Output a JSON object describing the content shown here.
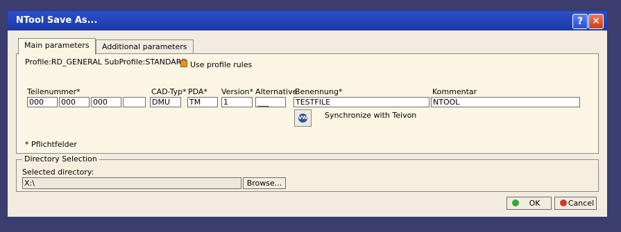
{
  "window": {
    "title": "NTool Save As...",
    "help_label": "?",
    "close_label": "✕"
  },
  "tabs": [
    {
      "label": "Main parameters",
      "active": true
    },
    {
      "label": "Additional parameters",
      "active": false
    }
  ],
  "profile": {
    "text": "Profile:RD_GENERAL SubProfile:STANDARD",
    "use_rules_label": "Use profile rules"
  },
  "fields": {
    "teilenummer_label": "Teilenummer*",
    "teilenummer_values": [
      "000",
      "000",
      "000",
      ""
    ],
    "cadtyp_label": "CAD-Typ*",
    "cadtyp_value": "DMU",
    "pda_label": "PDA*",
    "pda_value": "TM",
    "version_label": "Version*",
    "version_value": "1",
    "alternative_label": "Alternative",
    "alternative_value": "___",
    "benennung_label": "Benennung*",
    "benennung_value": "TESTFILE",
    "kommentar_label": "Kommentar",
    "kommentar_value": "NTOOL"
  },
  "sync": {
    "label": "Synchronize with Teivon",
    "icon": "vw-logo-icon",
    "logo_text": "VW"
  },
  "required_note": "* Pflichtfelder",
  "directory": {
    "group_title": "Directory Selection",
    "selected_label": "Selected directory:",
    "value": "X:\\",
    "browse_label": "Browse..."
  },
  "buttons": {
    "ok_label": "OK",
    "cancel_label": "Cancel"
  },
  "colors": {
    "titlebar": "#1b3aa8",
    "dialog_bg": "#f1ecdf",
    "panel_bg": "#fbf5e4",
    "checkbox": "#e8951e"
  }
}
